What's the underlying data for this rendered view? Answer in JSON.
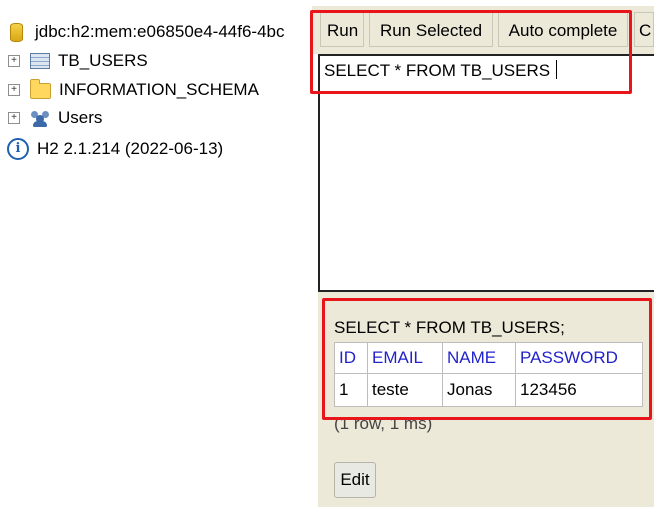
{
  "tree": {
    "connection": "jdbc:h2:mem:e06850e4-44f6-4bc",
    "items": [
      {
        "label": "TB_USERS",
        "icon": "table-icon"
      },
      {
        "label": "INFORMATION_SCHEMA",
        "icon": "folder-icon"
      },
      {
        "label": "Users",
        "icon": "users-icon"
      }
    ],
    "version": "H2 2.1.214 (2022-06-13)"
  },
  "toolbar": {
    "run": "Run",
    "run_selected": "Run Selected",
    "auto_complete": "Auto complete",
    "clear": "C"
  },
  "editor": {
    "sql": "SELECT * FROM TB_USERS"
  },
  "results": {
    "query": "SELECT * FROM TB_USERS;",
    "columns": [
      "ID",
      "EMAIL",
      "NAME",
      "PASSWORD"
    ],
    "rows": [
      [
        "1",
        "teste",
        "Jonas",
        "123456"
      ]
    ],
    "row_count": "(1 row, 1 ms)",
    "edit": "Edit"
  },
  "colors": {
    "highlight": "#e8151b",
    "toolbar_bg": "#ece9d8",
    "column_header": "#2222cc"
  }
}
